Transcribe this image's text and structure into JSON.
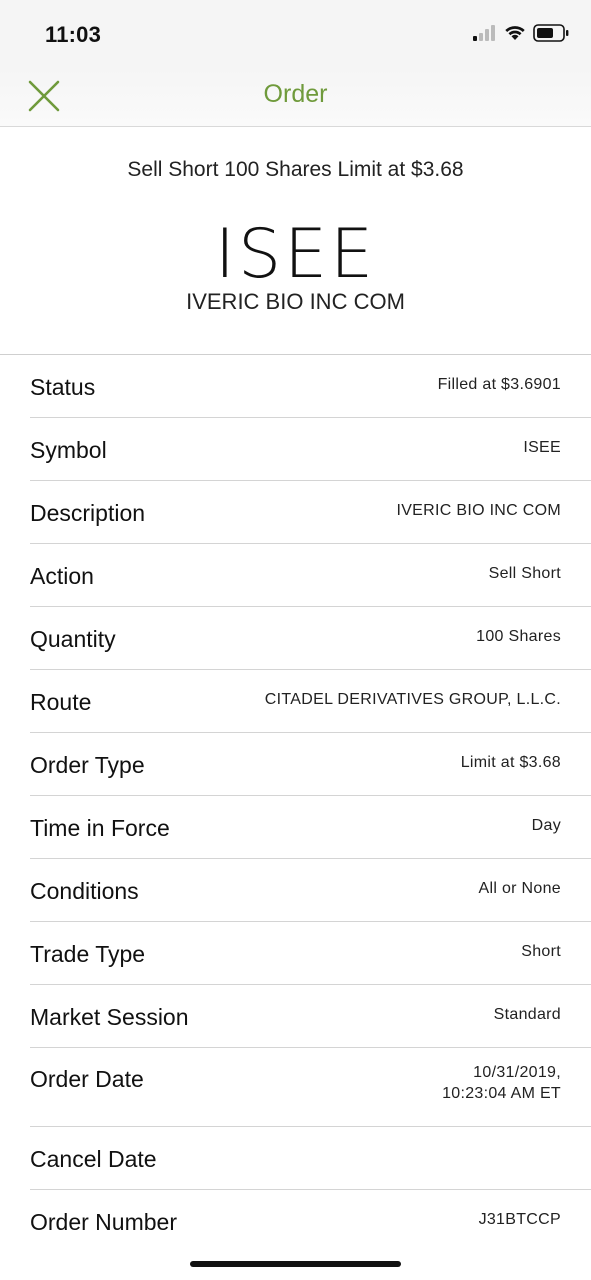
{
  "status_bar": {
    "time": "11:03"
  },
  "nav": {
    "title": "Order",
    "close_icon": "close-icon"
  },
  "summary": {
    "line": "Sell Short 100 Shares Limit at $3.68",
    "symbol": "ISEE",
    "company": "IVERIC BIO INC COM"
  },
  "details": [
    {
      "label": "Status",
      "value": "Filled at $3.6901"
    },
    {
      "label": "Symbol",
      "value": "ISEE"
    },
    {
      "label": "Description",
      "value": "IVERIC BIO INC COM"
    },
    {
      "label": "Action",
      "value": "Sell Short"
    },
    {
      "label": "Quantity",
      "value": "100 Shares"
    },
    {
      "label": "Route",
      "value": "CITADEL DERIVATIVES GROUP, L.L.C."
    },
    {
      "label": "Order Type",
      "value": "Limit at $3.68"
    },
    {
      "label": "Time in Force",
      "value": "Day"
    },
    {
      "label": "Conditions",
      "value": "All or None"
    },
    {
      "label": "Trade Type",
      "value": "Short"
    },
    {
      "label": "Market Session",
      "value": "Standard"
    },
    {
      "label": "Order Date",
      "value_line1": "10/31/2019,",
      "value_line2": "10:23:04 AM ET"
    },
    {
      "label": "Cancel Date",
      "value": ""
    },
    {
      "label": "Order Number",
      "value": "J31BTCCP"
    }
  ],
  "colors": {
    "accent": "#6f9a3b",
    "divider": "#d4d4d4"
  }
}
